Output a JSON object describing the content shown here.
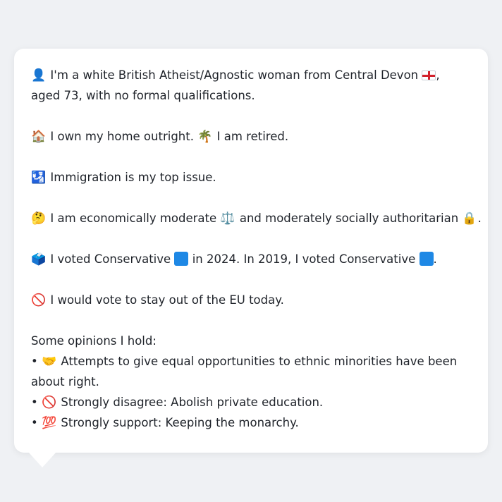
{
  "profile": {
    "identity": {
      "icon": "bust-in-silhouette-icon",
      "text_before_flag": "I'm a white British Atheist/Agnostic woman from Central Devon",
      "flag": "england-flag-icon",
      "text_after_flag": ", aged 73, with no formal qualifications."
    },
    "home": {
      "icon": "house-icon",
      "text": "I own my home outright.",
      "retired_icon": "palm-tree-icon",
      "retired_text": "I am retired."
    },
    "issue": {
      "icon": "immigration-icon",
      "text": "Immigration is my top issue."
    },
    "ideology": {
      "icon": "thinking-face-icon",
      "text_econ": "I am economically moderate",
      "econ_icon": "balance-scale-icon",
      "text_social": "and moderately socially authoritarian",
      "social_icon": "lock-icon",
      "end_punct": "."
    },
    "votes": {
      "icon": "ballot-box-icon",
      "text_2024": "I voted Conservative",
      "party_color": "#1e88e5",
      "text_mid": "in 2024. In 2019, I voted Conservative",
      "end_punct": "."
    },
    "eu": {
      "icon": "prohibited-icon",
      "text": "I would vote to stay out of the EU today."
    },
    "opinions": {
      "heading": "Some opinions I hold:",
      "bullet": "•",
      "items": [
        {
          "icon": "handshake-icon",
          "text": "Attempts to give equal opportunities to ethnic minorities have been about right."
        },
        {
          "icon": "prohibited-icon",
          "text": "Strongly disagree: Abolish private education."
        },
        {
          "icon": "hundred-points-icon",
          "text": "Strongly support: Keeping the monarchy."
        }
      ]
    }
  }
}
